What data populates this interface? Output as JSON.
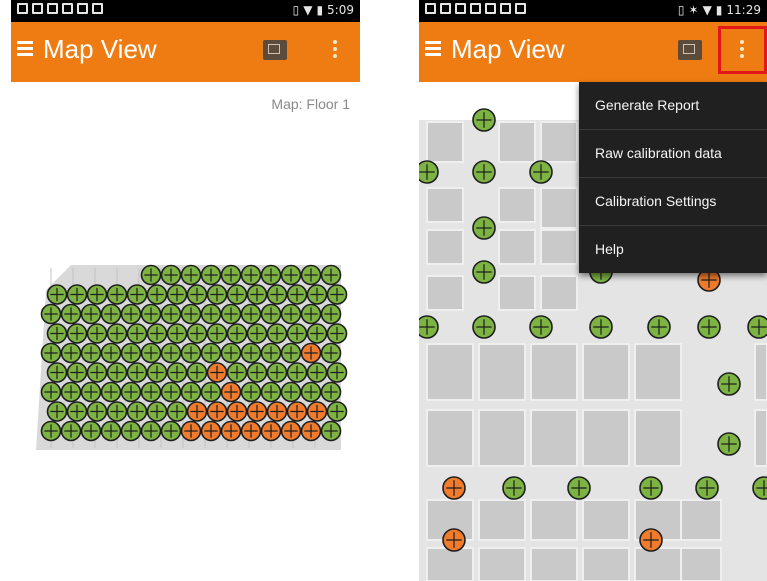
{
  "screens": [
    {
      "status_time": "5:09",
      "title": "Map View",
      "map_label": "Map: Floor 1",
      "icons": {
        "menu": "hamburger-icon",
        "map": "map-icon",
        "overflow": "overflow-menu-icon"
      }
    },
    {
      "status_time": "11:29",
      "title": "Map View",
      "icons": {
        "menu": "hamburger-icon",
        "map": "map-icon",
        "overflow": "overflow-menu-icon"
      },
      "menu_items": [
        "Generate Report",
        "Raw calibration data",
        "Calibration Settings",
        "Help"
      ]
    }
  ],
  "colors": {
    "appbar": "#ee7c12",
    "statusbar": "#000000",
    "point_calibrated": "#7cb342",
    "point_pending": "#f07b2c",
    "highlight": "#e01818",
    "menu_bg": "#202020"
  }
}
